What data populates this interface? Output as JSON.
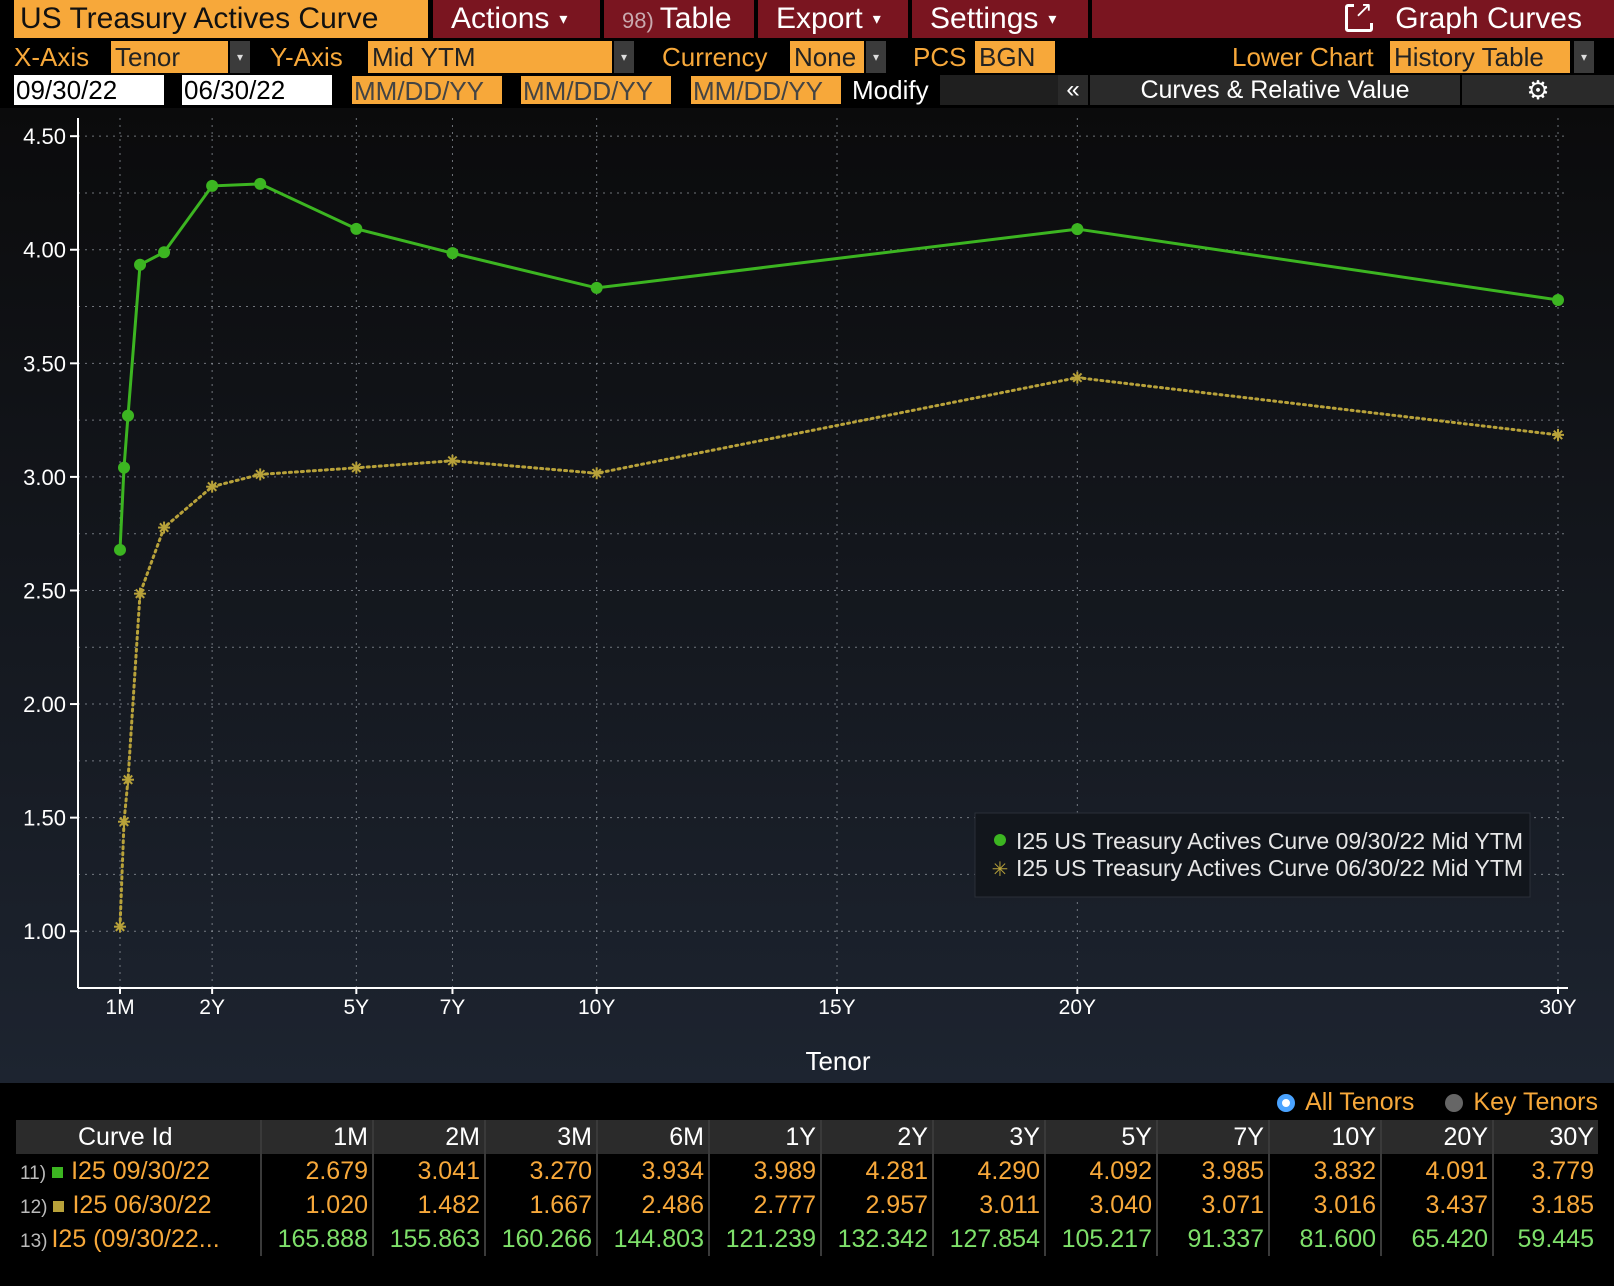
{
  "menubar": {
    "title": "US Treasury Actives Curve",
    "actions": "Actions",
    "table_badge": "98)",
    "table": "Table",
    "export": "Export",
    "settings": "Settings",
    "graph_curves": "Graph Curves",
    "caret": "▾"
  },
  "params": {
    "xaxis_label": "X-Axis",
    "xaxis_value": "Tenor",
    "yaxis_label": "Y-Axis",
    "yaxis_value": "Mid YTM",
    "currency_label": "Currency",
    "currency_value": "None",
    "pcs_label": "PCS",
    "pcs_value": "BGN",
    "lower_chart_label": "Lower Chart",
    "lower_chart_value": "History Table",
    "dropdown": "▾"
  },
  "dates": {
    "date1": "09/30/22",
    "date2": "06/30/22",
    "date3": "MM/DD/YY",
    "date4": "MM/DD/YY",
    "date5": "MM/DD/YY",
    "modify": "Modify",
    "collapse": "«",
    "curves_rv": "Curves & Relative Value",
    "gear": "⚙"
  },
  "chart_data": {
    "type": "line",
    "xlabel": "Tenor",
    "ylabel": "",
    "ylim": [
      0.75,
      4.58
    ],
    "xlim_years": [
      -0.3,
      30.5
    ],
    "x_ticks": [
      {
        "label": "1M",
        "years": 0.0833
      },
      {
        "label": "2Y",
        "years": 2
      },
      {
        "label": "5Y",
        "years": 5
      },
      {
        "label": "7Y",
        "years": 7
      },
      {
        "label": "10Y",
        "years": 10
      },
      {
        "label": "15Y",
        "years": 15
      },
      {
        "label": "20Y",
        "years": 20
      },
      {
        "label": "30Y",
        "years": 30
      }
    ],
    "y_ticks": [
      "4.50",
      "4.00",
      "3.50",
      "3.00",
      "2.50",
      "2.00",
      "1.50",
      "1.00"
    ],
    "y_tick_values": [
      4.5,
      4.0,
      3.5,
      3.0,
      2.5,
      2.0,
      1.5,
      1.0
    ],
    "grid": true,
    "legend_position": "bottom-right",
    "series": [
      {
        "name": "I25 US Treasury Actives Curve 09/30/22 Mid YTM",
        "color": "#3cb521",
        "marker": "dot",
        "line_style": "solid",
        "x_years": [
          0.0833,
          0.1667,
          0.25,
          0.5,
          1,
          2,
          3,
          5,
          7,
          10,
          20,
          30
        ],
        "values": [
          2.679,
          3.041,
          3.27,
          3.934,
          3.989,
          4.281,
          4.29,
          4.092,
          3.985,
          3.832,
          4.091,
          3.779
        ]
      },
      {
        "name": "I25 US Treasury Actives Curve 06/30/22 Mid YTM",
        "color": "#b8a23a",
        "marker": "star",
        "line_style": "dotted",
        "x_years": [
          0.0833,
          0.1667,
          0.25,
          0.5,
          1,
          2,
          3,
          5,
          7,
          10,
          20,
          30
        ],
        "values": [
          1.02,
          1.482,
          1.667,
          2.486,
          2.777,
          2.957,
          3.011,
          3.04,
          3.071,
          3.016,
          3.437,
          3.185
        ]
      }
    ]
  },
  "tenor_toggle": {
    "all": "All Tenors",
    "key": "Key Tenors"
  },
  "table": {
    "headers": [
      "Curve Id",
      "1M",
      "2M",
      "3M",
      "6M",
      "1Y",
      "2Y",
      "3Y",
      "5Y",
      "7Y",
      "10Y",
      "20Y",
      "30Y"
    ],
    "rows": [
      {
        "num": "11)",
        "id": "I25 09/30/22",
        "swatch": "#3cb521",
        "values": [
          "2.679",
          "3.041",
          "3.270",
          "3.934",
          "3.989",
          "4.281",
          "4.290",
          "4.092",
          "3.985",
          "3.832",
          "4.091",
          "3.779"
        ]
      },
      {
        "num": "12)",
        "id": "I25 06/30/22",
        "swatch": "#b8a23a",
        "values": [
          "1.020",
          "1.482",
          "1.667",
          "2.486",
          "2.777",
          "2.957",
          "3.011",
          "3.040",
          "3.071",
          "3.016",
          "3.437",
          "3.185"
        ]
      },
      {
        "num": "13)",
        "id": "I25 (09/30/22...",
        "values": [
          "165.888",
          "155.863",
          "160.266",
          "144.803",
          "121.239",
          "132.342",
          "127.854",
          "105.217",
          "91.337",
          "81.600",
          "65.420",
          "59.445"
        ]
      }
    ]
  }
}
